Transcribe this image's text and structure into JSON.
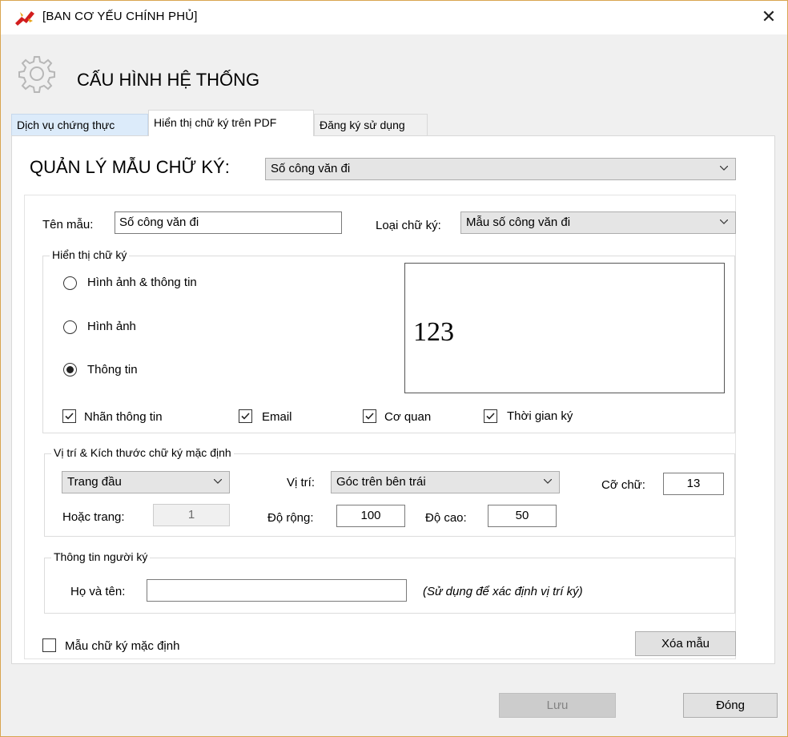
{
  "window": {
    "title": "[BAN CƠ YẾU CHÍNH PHỦ]",
    "close_glyph": "✕"
  },
  "header": {
    "title": "CẤU HÌNH HỆ THỐNG",
    "icon": "gear-icon"
  },
  "tabs": [
    {
      "label": "Dịch vụ chứng thực",
      "selected": false
    },
    {
      "label": "Hiển thị chữ ký trên PDF",
      "selected": true
    },
    {
      "label": "Đăng ký sử dụng",
      "selected": false
    }
  ],
  "template_manager": {
    "label": "QUẢN LÝ MẪU CHỮ KÝ:",
    "selected": "Số công văn đi"
  },
  "template_name": {
    "label": "Tên mẫu:",
    "value": "Số công văn đi"
  },
  "signature_type": {
    "label": "Loại chữ ký:",
    "selected": "Mẫu số công văn đi"
  },
  "display_group": {
    "title": "Hiển thị chữ ký",
    "options": [
      {
        "label": "Hình ảnh & thông tin",
        "selected": false
      },
      {
        "label": "Hình ảnh",
        "selected": false
      },
      {
        "label": "Thông tin",
        "selected": true
      }
    ],
    "preview_text": "123",
    "checkboxes": [
      {
        "label": "Nhãn thông tin",
        "checked": true
      },
      {
        "label": "Email",
        "checked": true
      },
      {
        "label": "Cơ quan",
        "checked": true
      },
      {
        "label": "Thời gian ký",
        "checked": true
      }
    ]
  },
  "position_group": {
    "title": "Vị trí  & Kích thước chữ ký mặc định",
    "page_select": "Trang đầu",
    "position_label": "Vị trí:",
    "position_select": "Góc trên bên trái",
    "font_size_label": "Cỡ chữ:",
    "font_size_value": "13",
    "or_page_label": "Hoặc trang:",
    "or_page_value": "1",
    "width_label": "Độ rộng:",
    "width_value": "100",
    "height_label": "Độ cao:",
    "height_value": "50"
  },
  "signer_group": {
    "title": "Thông tin người ký",
    "name_label": "Họ và tên:",
    "name_value": "",
    "hint": "(Sử dụng để xác định vị trí ký)"
  },
  "default_template": {
    "label": "Mẫu chữ ký mặc định",
    "checked": false
  },
  "buttons": {
    "delete": "Xóa mẫu",
    "save": "Lưu",
    "close": "Đóng"
  },
  "colors": {
    "accent_border": "#d9a550",
    "tab_blue": "#dcebfa",
    "logo_red": "#d21d1d"
  }
}
